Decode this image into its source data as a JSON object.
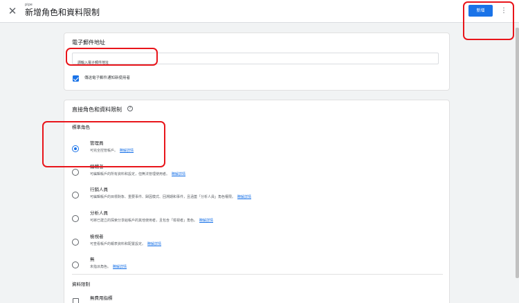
{
  "header": {
    "subtitle": "pipe",
    "title": "新增角色和資料限制",
    "add_label": "新增",
    "close_glyph": "✕",
    "more_glyph": "⋮"
  },
  "email_card": {
    "title": "電子郵件地址",
    "input_placeholder": "請輸入電子郵件地址",
    "notify_label": "傳送電子郵件通知新使用者",
    "notify_checked": true
  },
  "role_card": {
    "title": "直接角色和資料限制",
    "help_glyph": "?",
    "standard_roles_label": "標準角色",
    "link_label": "瞭解詳情",
    "roles": [
      {
        "name": "管理員",
        "desc": "可完全控管帳戶。",
        "checked": true
      },
      {
        "name": "編輯者",
        "desc": "可編輯帳戶的所有資料和設定，但無法管理使用者。",
        "checked": false
      },
      {
        "name": "行銷人員",
        "desc": "可編輯帳戶的目標對象、重要事件、歸因模式、回溯期和事件，且涵蓋「分析人員」角色權限。",
        "checked": false
      },
      {
        "name": "分析人員",
        "desc": "可將已建立的探索分享給帳戶的其他使用者，且包含「檢視者」角色。",
        "checked": false
      },
      {
        "name": "檢視者",
        "desc": "可查看帳戶的報表資料和配置設定。",
        "checked": false
      },
      {
        "name": "無",
        "desc": "未指派角色。",
        "checked": false
      }
    ],
    "data_restrictions_label": "資料限制",
    "no_cost_metrics_label": "無費用指標"
  },
  "annotation_color": "#e8141a",
  "accent_color": "#1a73e8"
}
